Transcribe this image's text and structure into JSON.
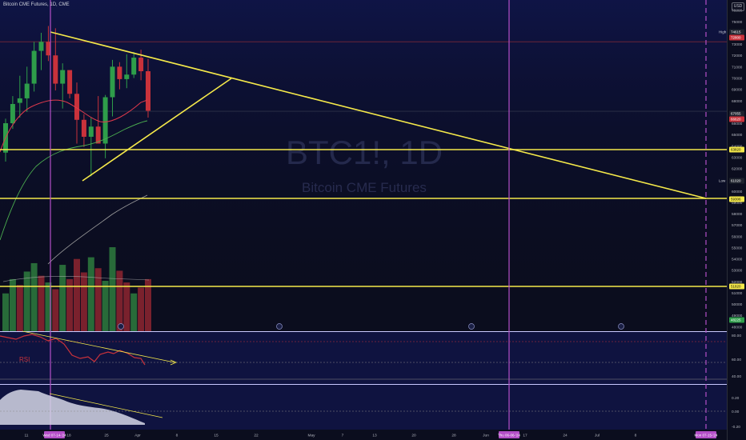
{
  "header": {
    "title": "Bitcoin CME Futures, 1D, CME",
    "currency": "USD"
  },
  "watermark": {
    "symbol": "BTC1!, 1D",
    "name": "Bitcoin CME Futures"
  },
  "colors": {
    "background": "#0b0d1e",
    "up": "#2e9d4a",
    "down": "#c9323b",
    "trendline": "#f5e94a",
    "vline": "#b44fc8",
    "ma_fast": "#e0394c",
    "ma_mid": "#4caf50",
    "ma_slow": "#9e9e9e",
    "rsi": "#c9323b"
  },
  "chart_data": {
    "type": "candlestick",
    "title": "Bitcoin CME Futures, 1D, CME",
    "ylabel": "USD",
    "ylim": [
      47600,
      76900
    ],
    "y_ticks": [
      76000,
      75000,
      74000,
      73000,
      72000,
      71000,
      70000,
      69000,
      68000,
      67000,
      66000,
      65000,
      64000,
      63000,
      62000,
      61000,
      60000,
      59000,
      58000,
      57000,
      56000,
      55000,
      54000,
      53000,
      52000,
      51000,
      50000,
      49000,
      48000
    ],
    "x_ticks": [
      "11",
      "Wed 07-14-'24",
      "18",
      "25",
      "Apr",
      "8",
      "15",
      "22",
      "May",
      "7",
      "13",
      "20",
      "28",
      "Jun",
      "Thu 06-06-'24",
      "17",
      "24",
      "Jul",
      "8",
      "Mon 07-15-'24"
    ],
    "candles": [
      {
        "o": 63400,
        "h": 66400,
        "l": 62600,
        "c": 66000
      },
      {
        "o": 66000,
        "h": 68400,
        "l": 65500,
        "c": 67700
      },
      {
        "o": 67800,
        "h": 70200,
        "l": 66500,
        "c": 68200
      },
      {
        "o": 68200,
        "h": 71000,
        "l": 67000,
        "c": 69500
      },
      {
        "o": 69500,
        "h": 73200,
        "l": 68800,
        "c": 72400
      },
      {
        "o": 72400,
        "h": 74000,
        "l": 70700,
        "c": 73200
      },
      {
        "o": 73200,
        "h": 74600,
        "l": 71500,
        "c": 72000
      },
      {
        "o": 72000,
        "h": 74400,
        "l": 68900,
        "c": 69500
      },
      {
        "o": 69500,
        "h": 71300,
        "l": 67300,
        "c": 70700
      },
      {
        "o": 70700,
        "h": 70500,
        "l": 68200,
        "c": 68600
      },
      {
        "o": 68600,
        "h": 69600,
        "l": 64200,
        "c": 66300
      },
      {
        "o": 66300,
        "h": 66800,
        "l": 63900,
        "c": 64800
      },
      {
        "o": 64800,
        "h": 66500,
        "l": 61300,
        "c": 65700
      },
      {
        "o": 65700,
        "h": 68400,
        "l": 64800,
        "c": 64200
      },
      {
        "o": 64200,
        "h": 68500,
        "l": 62900,
        "c": 68300
      },
      {
        "o": 68300,
        "h": 71600,
        "l": 66600,
        "c": 71000
      },
      {
        "o": 71000,
        "h": 71400,
        "l": 69000,
        "c": 69900
      },
      {
        "o": 69900,
        "h": 72100,
        "l": 69100,
        "c": 70300
      },
      {
        "o": 70300,
        "h": 72300,
        "l": 70000,
        "c": 71800
      },
      {
        "o": 71800,
        "h": 72500,
        "l": 69800,
        "c": 70600
      },
      {
        "o": 70600,
        "h": 71700,
        "l": 66500,
        "c": 67100
      }
    ],
    "volume": [
      {
        "v": 0.45,
        "up": true
      },
      {
        "v": 0.62,
        "up": true
      },
      {
        "v": 0.55,
        "up": false
      },
      {
        "v": 0.71,
        "up": true
      },
      {
        "v": 0.81,
        "up": true
      },
      {
        "v": 0.66,
        "up": false
      },
      {
        "v": 0.58,
        "up": true
      },
      {
        "v": 0.5,
        "up": false
      },
      {
        "v": 0.79,
        "up": true
      },
      {
        "v": 0.62,
        "up": false
      },
      {
        "v": 0.86,
        "up": false
      },
      {
        "v": 0.7,
        "up": false
      },
      {
        "v": 0.88,
        "up": true
      },
      {
        "v": 0.75,
        "up": false
      },
      {
        "v": 0.6,
        "up": true
      },
      {
        "v": 1.0,
        "up": true
      },
      {
        "v": 0.72,
        "up": false
      },
      {
        "v": 0.58,
        "up": false
      },
      {
        "v": 0.45,
        "up": true
      },
      {
        "v": 0.52,
        "up": false
      },
      {
        "v": 0.62,
        "up": false
      }
    ],
    "price_labels": [
      {
        "label": "High",
        "value": "74615",
        "bg": "#1e222d"
      },
      {
        "value": "72800",
        "bg": "#c9323b"
      },
      {
        "value": "67055",
        "bg": "#1e222d"
      },
      {
        "value": "66620",
        "bg": "#c9323b"
      },
      {
        "value": "63820",
        "bg": "#f5e94a"
      },
      {
        "label": "Low",
        "value": "61020",
        "bg": "#1e222d"
      },
      {
        "value": "59306",
        "bg": "#f5e94a"
      },
      {
        "value": "51820",
        "bg": "#f5e94a"
      },
      {
        "value": "48225",
        "bg": "#2e9d4a"
      }
    ],
    "rsi": {
      "label": "RSI",
      "levels": [
        "80.00",
        "60.00",
        "40.00"
      ]
    },
    "osc": {
      "levels": [
        "0.20",
        "0.00",
        "-0.20"
      ]
    },
    "date_markers": [
      "Wed 07-14-'24",
      "Thu 06-06-'24",
      "Mon 07-15-'24"
    ]
  }
}
